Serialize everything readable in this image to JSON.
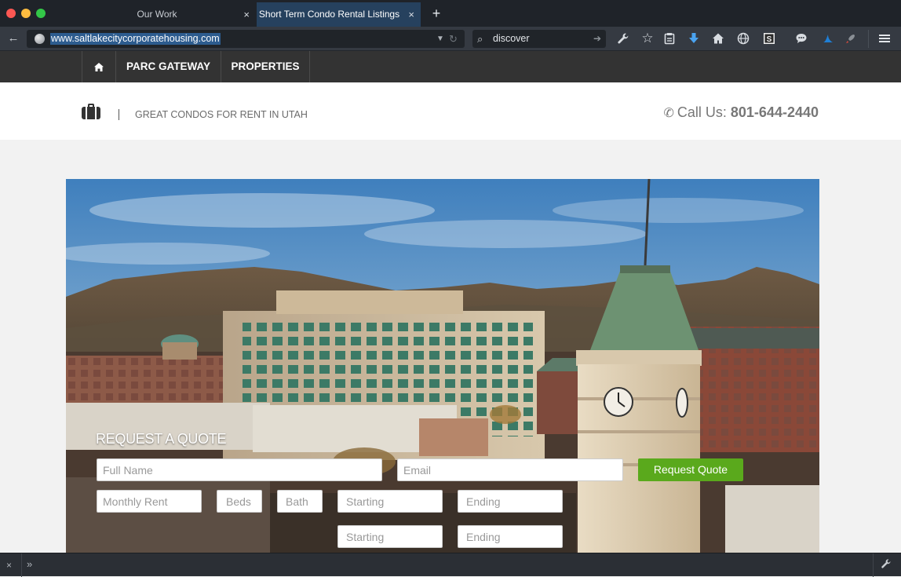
{
  "browser": {
    "tabs": [
      {
        "label": "Our Work",
        "active": false
      },
      {
        "label": "Short Term Condo Rental Listings",
        "active": true
      }
    ],
    "new_tab": "+",
    "tab_close": "×",
    "url": "www.saltlakecitycorporatehousing.com",
    "search_value": "discover",
    "icons": [
      "back-arrow-icon",
      "globe-icon",
      "dropdown-icon",
      "reload-icon",
      "search-icon",
      "go-arrow-icon",
      "wrench-icon",
      "star-icon",
      "clipboard-icon",
      "download-icon",
      "home-icon",
      "globe-grid-icon",
      "s-icon",
      "chat-icon",
      "shark-icon",
      "rocket-icon",
      "hamburger-menu-icon"
    ],
    "colors": {
      "tabbar": "#1f2329",
      "active_tab": "#26415e",
      "toolbar": "#353a42",
      "url_highlight": "#2d5c8f"
    }
  },
  "site": {
    "nav": {
      "home_icon": "home-icon",
      "items": [
        "PARC GATEWAY",
        "PROPERTIES"
      ]
    },
    "header": {
      "icon": "briefcase-icon",
      "tagline": "GREAT CONDOS FOR RENT IN UTAH",
      "call_label": "Call Us:",
      "phone": "801-644-2440"
    },
    "quote_form": {
      "title": "REQUEST A QUOTE",
      "full_name_placeholder": "Full Name",
      "email_placeholder": "Email",
      "submit_label": "Request Quote",
      "monthly_rent_placeholder": "Monthly Rent",
      "beds_placeholder": "Beds",
      "bath_placeholder": "Bath",
      "starting_placeholder": "Starting",
      "ending_placeholder": "Ending",
      "starting2_placeholder": "Starting",
      "ending2_placeholder": "Ending"
    },
    "colors": {
      "nav_bg": "#333333",
      "button": "#5aa91c",
      "page_bg": "#f2f2f2"
    }
  },
  "addon_bar": {
    "close": "×",
    "more": "»"
  }
}
